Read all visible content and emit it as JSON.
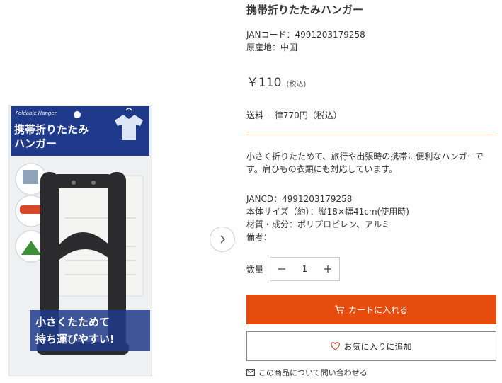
{
  "product": {
    "title": "携帯折りたたみハンガー",
    "jan_line": "JANコード：4991203179258",
    "origin_line": "原産地：中国",
    "price": "￥110",
    "tax_note": "(税込)",
    "shipping": "送料 一律770円（税込）",
    "description": "小さく折りたためて、旅行や出張時の携帯に便利なハンガーです。肩ひもの衣類にも対応しています。",
    "specs": [
      "JANCD：4991203179258",
      "本体サイズ（約）：縦18×幅41cm(使用時)",
      "材質・成分：ポリプロピレン、アルミ",
      "備考："
    ]
  },
  "package": {
    "sublabel": "Foldable Hanger",
    "title_line1": "携帯折りたたみ",
    "title_line2": "ハンガー",
    "slogan_line1": "小さくたためて",
    "slogan_line2": "持ち運びやすい!"
  },
  "quantity": {
    "label": "数量",
    "value": "1",
    "minus": "−",
    "plus": "+"
  },
  "buttons": {
    "cart": "カートに入れる",
    "favorite": "お気に入りに追加",
    "inquiry": "この商品について問い合わせる"
  },
  "colors": {
    "accent": "#e74c0f",
    "divider": "#e8a070",
    "package_blue": "#1f3a8a"
  },
  "icons": {
    "next": "chevron-right-icon",
    "cart": "cart-icon",
    "favorite": "heart-icon",
    "inquiry": "mail-icon"
  }
}
